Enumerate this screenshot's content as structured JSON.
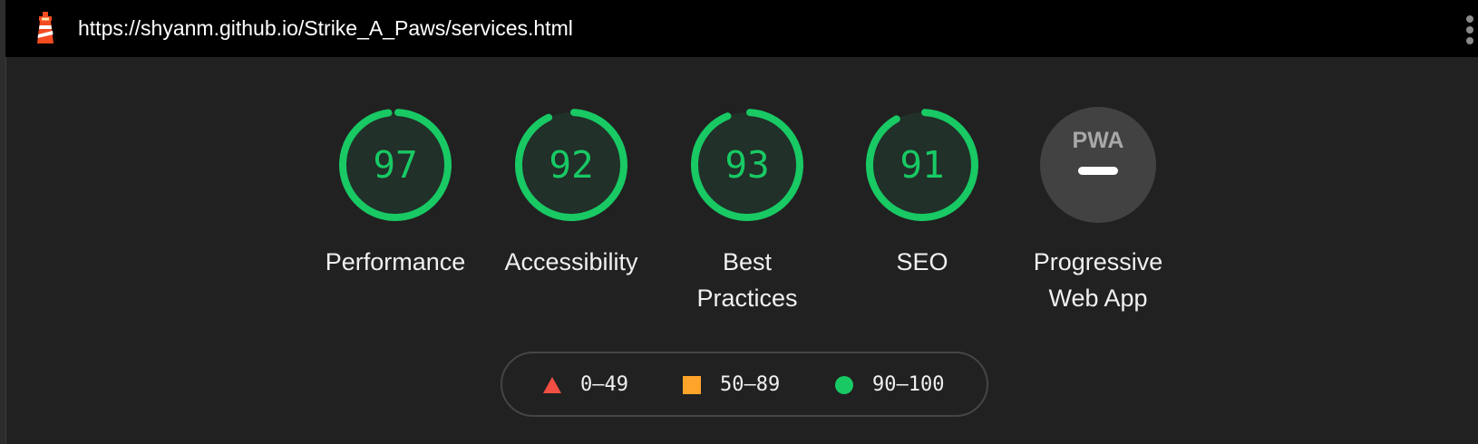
{
  "header": {
    "url": "https://shyanm.github.io/Strike_A_Paws/services.html",
    "logo_icon": "lighthouse-icon",
    "menu_icon": "more-vert-icon"
  },
  "gauges": [
    {
      "score": "97",
      "label": "Performance",
      "value": 97,
      "color": "#18c964"
    },
    {
      "score": "92",
      "label": "Accessibility",
      "value": 92,
      "color": "#18c964"
    },
    {
      "score": "93",
      "label": "Best Practices",
      "value": 93,
      "color": "#18c964"
    },
    {
      "score": "91",
      "label": "SEO",
      "value": 91,
      "color": "#18c964"
    }
  ],
  "pwa": {
    "badge_text": "PWA",
    "label_line1": "Progressive",
    "label_line2": "Web App",
    "icon": "pwa-icon"
  },
  "legend": {
    "fail": {
      "range": "0–49",
      "color": "#f24e43",
      "icon": "triangle-icon"
    },
    "average": {
      "range": "50–89",
      "color": "#ffa42a",
      "icon": "square-icon"
    },
    "pass": {
      "range": "90–100",
      "color": "#18c964",
      "icon": "circle-icon"
    }
  }
}
